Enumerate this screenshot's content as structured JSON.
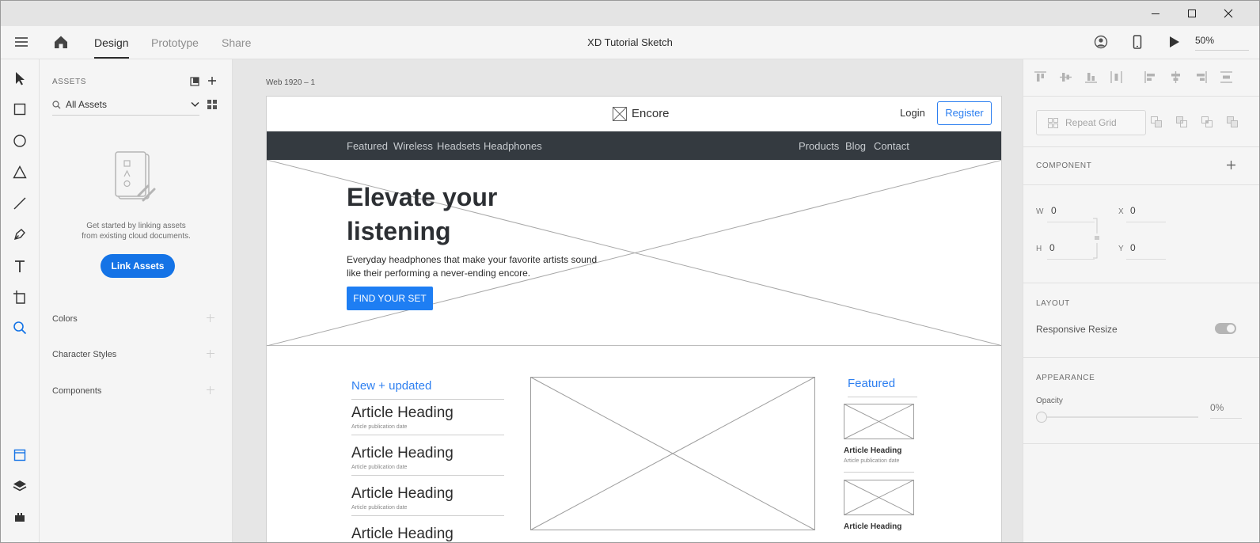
{
  "titlebar": {
    "minimize_icon": "minimize-icon",
    "maximize_icon": "maximize-icon",
    "close_icon": "close-icon"
  },
  "topbar": {
    "tabs": [
      "Design",
      "Prototype",
      "Share"
    ],
    "document_title": "XD Tutorial Sketch",
    "zoom": "50%"
  },
  "toolbar": {
    "tools": [
      "select-tool-icon",
      "rectangle-tool-icon",
      "ellipse-tool-icon",
      "polygon-tool-icon",
      "line-tool-icon",
      "pen-tool-icon",
      "text-tool-icon",
      "artboard-tool-icon",
      "zoom-tool-icon",
      "assets-panel-icon",
      "layers-panel-icon",
      "plugins-panel-icon"
    ]
  },
  "assets": {
    "heading": "ASSETS",
    "filter_value": "All Assets",
    "empty_message_line1": "Get started by linking assets",
    "empty_message_line2": "from existing cloud documents.",
    "link_button": "Link Assets",
    "sections": [
      "Colors",
      "Character Styles",
      "Components"
    ]
  },
  "canvas": {
    "artboard_label": "Web 1920 – 1",
    "brand": "Encore",
    "login": "Login",
    "register": "Register",
    "nav_left": [
      "Featured",
      "Wireless",
      "Headsets",
      "Headphones"
    ],
    "nav_right": [
      "Products",
      "Blog",
      "Contact"
    ],
    "hero_title_line1": "Elevate your",
    "hero_title_line2": "listening",
    "hero_text_line1": "Everyday headphones that make your favorite artists sound",
    "hero_text_line2": "like their performing a never-ending encore.",
    "hero_button": "FIND YOUR SET",
    "new_updated": "New + updated",
    "articles": [
      {
        "heading": "Article Heading",
        "date": "Article publication date"
      },
      {
        "heading": "Article Heading",
        "date": "Article publication date"
      },
      {
        "heading": "Article Heading",
        "date": "Article publication date"
      },
      {
        "heading": "Article Heading",
        "date": ""
      }
    ],
    "featured": "Featured",
    "featured_items": [
      {
        "heading": "Article Heading",
        "date": "Article publication date"
      },
      {
        "heading": "Article Heading",
        "date": ""
      }
    ]
  },
  "props": {
    "repeat_grid": "Repeat Grid",
    "component_label": "COMPONENT",
    "w_label": "W",
    "w_value": "0",
    "h_label": "H",
    "h_value": "0",
    "x_label": "X",
    "x_value": "0",
    "y_label": "Y",
    "y_value": "0",
    "layout_label": "LAYOUT",
    "responsive_resize": "Responsive Resize",
    "responsive_resize_on": true,
    "appearance_label": "APPEARANCE",
    "opacity_label": "Opacity",
    "opacity_value": "0%"
  },
  "colors": {
    "accent": "#1473e6",
    "nav_bg": "#343a40",
    "link_blue": "#2d7ff0"
  }
}
